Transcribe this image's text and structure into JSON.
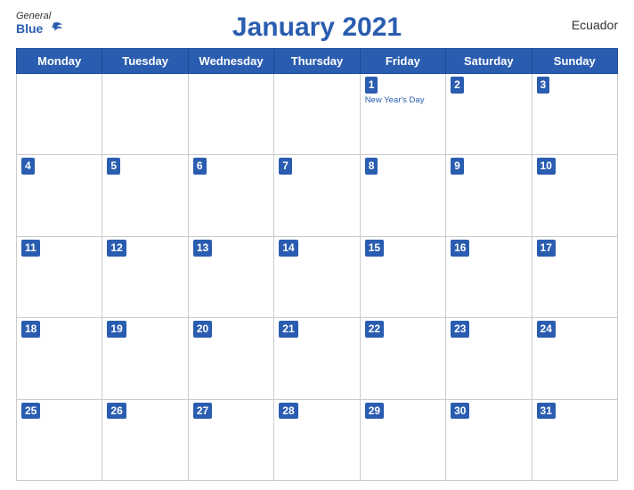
{
  "header": {
    "title": "January 2021",
    "country": "Ecuador",
    "logo": {
      "general": "General",
      "blue": "Blue"
    }
  },
  "weekdays": [
    "Monday",
    "Tuesday",
    "Wednesday",
    "Thursday",
    "Friday",
    "Saturday",
    "Sunday"
  ],
  "weeks": [
    [
      null,
      null,
      null,
      null,
      {
        "day": 1,
        "holiday": "New Year's Day"
      },
      {
        "day": 2
      },
      {
        "day": 3
      }
    ],
    [
      {
        "day": 4
      },
      {
        "day": 5
      },
      {
        "day": 6
      },
      {
        "day": 7
      },
      {
        "day": 8
      },
      {
        "day": 9
      },
      {
        "day": 10
      }
    ],
    [
      {
        "day": 11
      },
      {
        "day": 12
      },
      {
        "day": 13
      },
      {
        "day": 14
      },
      {
        "day": 15
      },
      {
        "day": 16
      },
      {
        "day": 17
      }
    ],
    [
      {
        "day": 18
      },
      {
        "day": 19
      },
      {
        "day": 20
      },
      {
        "day": 21
      },
      {
        "day": 22
      },
      {
        "day": 23
      },
      {
        "day": 24
      }
    ],
    [
      {
        "day": 25
      },
      {
        "day": 26
      },
      {
        "day": 27
      },
      {
        "day": 28
      },
      {
        "day": 29
      },
      {
        "day": 30
      },
      {
        "day": 31
      }
    ]
  ],
  "colors": {
    "header_bg": "#2a5db0",
    "accent": "#2a5db0"
  }
}
